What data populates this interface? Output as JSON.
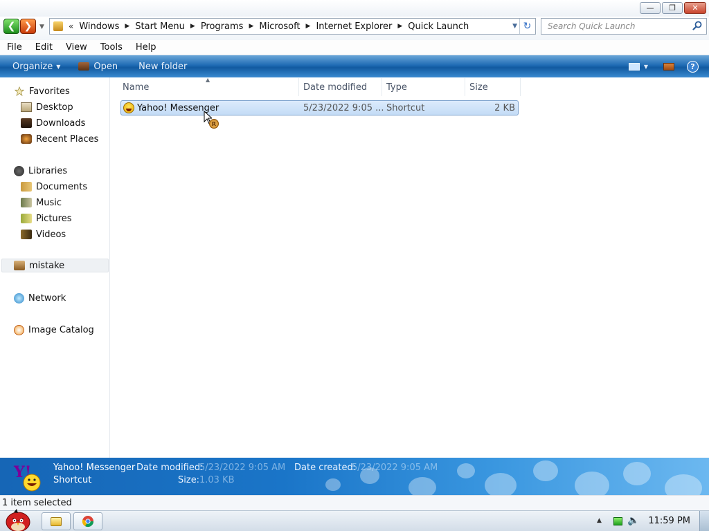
{
  "window": {
    "minimize_glyph": "—",
    "restore_glyph": "❐",
    "close_glyph": "✕"
  },
  "address": {
    "overflow_glyph": "«",
    "crumbs": [
      "Windows",
      "Start Menu",
      "Programs",
      "Microsoft",
      "Internet Explorer",
      "Quick Launch"
    ],
    "crumb_separator": "▶"
  },
  "search": {
    "placeholder": "Search Quick Launch"
  },
  "menubar": {
    "items": [
      "File",
      "Edit",
      "View",
      "Tools",
      "Help"
    ]
  },
  "commandbar": {
    "organize_label": "Organize",
    "open_label": "Open",
    "new_folder_label": "New folder",
    "help_glyph": "?"
  },
  "navpane": {
    "favorites": {
      "label": "Favorites",
      "items": [
        "Desktop",
        "Downloads",
        "Recent Places"
      ]
    },
    "libraries": {
      "label": "Libraries",
      "items": [
        "Documents",
        "Music",
        "Pictures",
        "Videos"
      ]
    },
    "user_label": "mistake",
    "network_label": "Network",
    "image_catalog_label": "Image Catalog"
  },
  "filelist": {
    "columns": [
      "Name",
      "Date modified",
      "Type",
      "Size"
    ],
    "rows": [
      {
        "name": "Yahoo! Messenger",
        "date_modified": "5/23/2022 9:05 ...",
        "type": "Shortcut",
        "size": "2 KB"
      }
    ],
    "cursor_badge": "R"
  },
  "details": {
    "name": "Yahoo! Messenger",
    "kind": "Shortcut",
    "date_modified_label": "Date modified:",
    "date_modified_value": "5/23/2022 9:05 AM",
    "date_created_label": "Date created:",
    "date_created_value": "5/23/2022 9:05 AM",
    "size_label": "Size:",
    "size_value": "1.03 KB"
  },
  "status": {
    "text": "1 item selected"
  },
  "taskbar": {
    "clock": "11:59 PM"
  },
  "colors": {
    "command_bar": "#1f6bb4",
    "details_pane": "#1a75c8",
    "selection": "#cde3f9"
  }
}
